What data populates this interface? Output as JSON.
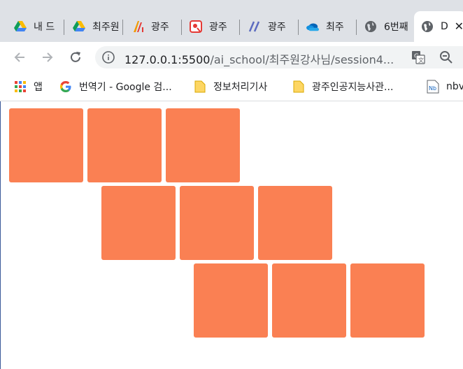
{
  "tabs": [
    {
      "title": "내 드",
      "icon": "google-drive-icon"
    },
    {
      "title": "최주원",
      "icon": "google-drive-icon"
    },
    {
      "title": "광주",
      "icon": "ai-logo-icon"
    },
    {
      "title": "광주",
      "icon": "location-pin-icon"
    },
    {
      "title": "광주",
      "icon": "slash-logo-icon"
    },
    {
      "title": "최주",
      "icon": "onedrive-cloud-icon"
    },
    {
      "title": "6번째",
      "icon": "globe-icon"
    },
    {
      "title": "D",
      "icon": "globe-icon",
      "active": true
    }
  ],
  "toolbar": {
    "url_host": "127.0.0.1:5500",
    "url_path": "/ai_school/최주원강사님/session4..."
  },
  "bookmarks": [
    {
      "label": "앱",
      "icon": "apps-grid-icon"
    },
    {
      "label": "번역기 - Google 검...",
      "icon": "google-g-icon"
    },
    {
      "label": "정보처리기사",
      "icon": "folder-icon"
    },
    {
      "label": "광주인공지능사관...",
      "icon": "folder-icon"
    },
    {
      "label": "nbv",
      "icon": "notebook-icon"
    }
  ],
  "colors": {
    "box": "#fa8053",
    "tabstrip": "#dee1e6"
  },
  "boxes": {
    "rows": 3,
    "per_row": 3
  }
}
